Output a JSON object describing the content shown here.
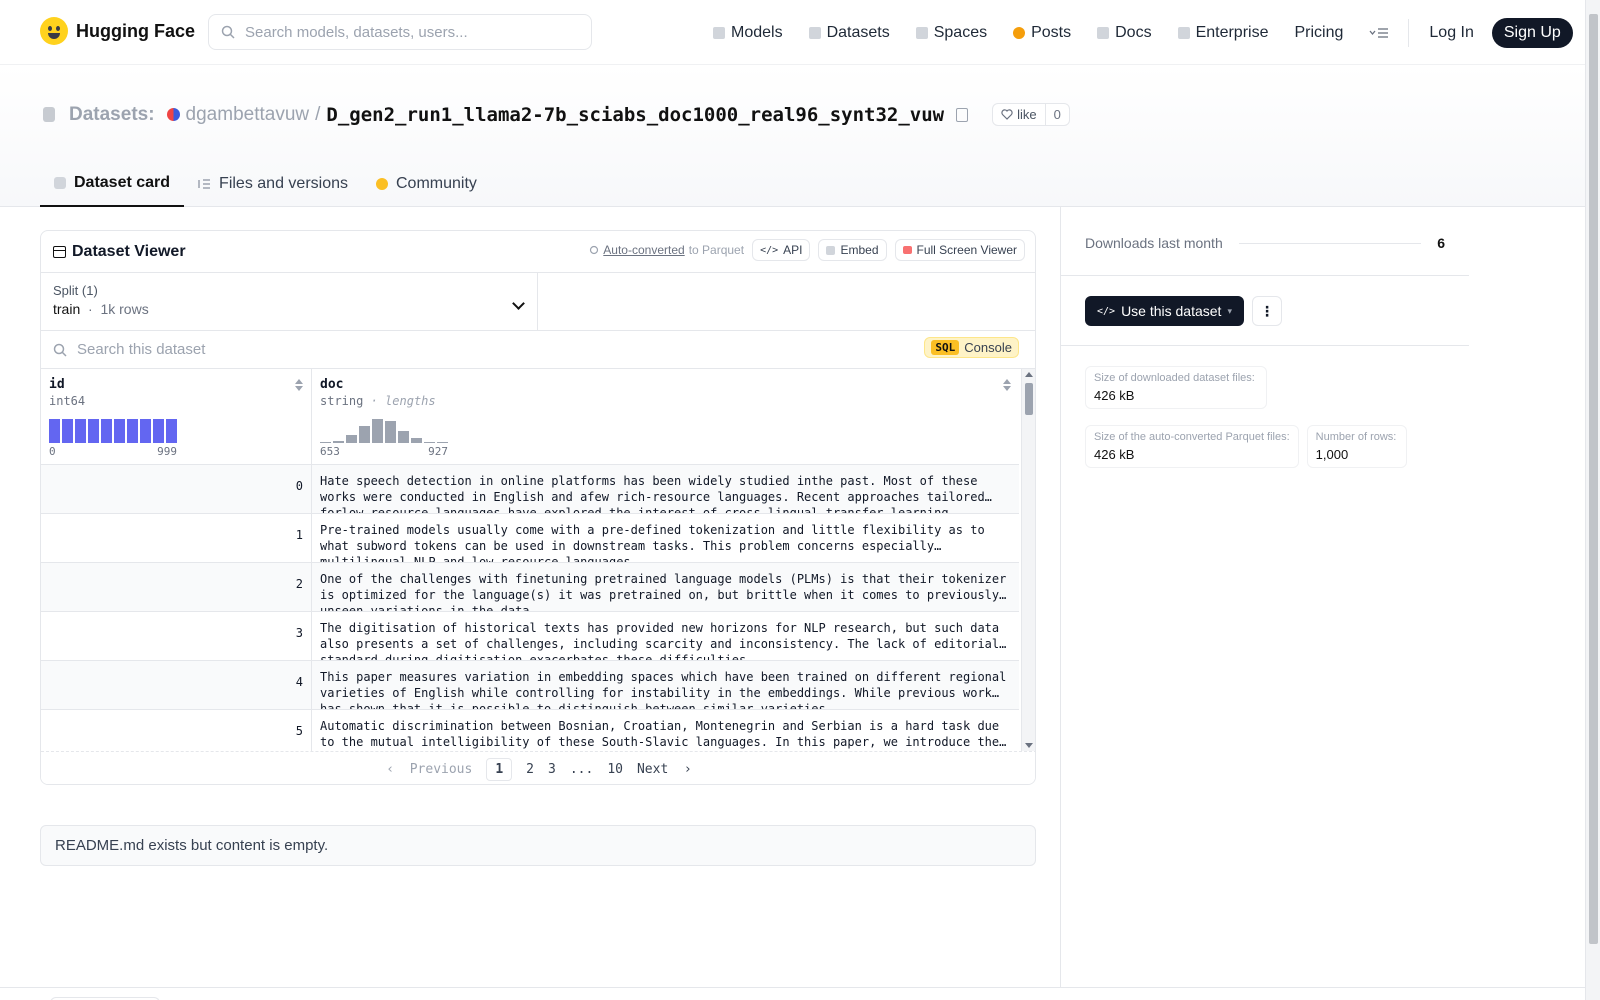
{
  "nav": {
    "brand": "Hugging Face",
    "search_placeholder": "Search models, datasets, users...",
    "links": [
      {
        "label": "Models",
        "color": "#d1d5db"
      },
      {
        "label": "Datasets",
        "color": "#d1d5db"
      },
      {
        "label": "Spaces",
        "color": "#d1d5db"
      },
      {
        "label": "Posts",
        "color": "#f59e0b"
      },
      {
        "label": "Docs",
        "color": "#d1d5db"
      },
      {
        "label": "Enterprise",
        "color": "#d1d5db"
      }
    ],
    "pricing": "Pricing",
    "login": "Log In",
    "signup": "Sign Up"
  },
  "header": {
    "section": "Datasets:",
    "owner": "dgambettavuw",
    "slash": "/",
    "name": "D_gen2_run1_llama2-7b_sciabs_doc1000_real96_synt32_vuw",
    "like_label": "like",
    "like_count": "0",
    "tabs": [
      "Dataset card",
      "Files and versions",
      "Community"
    ]
  },
  "viewer": {
    "title": "Dataset Viewer",
    "autoconv_link": "Auto-converted",
    "autoconv_suffix": "to Parquet",
    "api": "API",
    "embed": "Embed",
    "fullscreen": "Full Screen Viewer",
    "split_label": "Split (1)",
    "split_name": "train",
    "split_rows": "1k rows",
    "search_placeholder": "Search this dataset",
    "sql_badge": "SQL",
    "sql_label": "Console",
    "columns": [
      {
        "name": "id",
        "type": "int64",
        "min": "0",
        "max": "999",
        "hist": [
          1,
          1,
          1,
          1,
          1,
          1,
          1,
          1,
          1,
          1
        ]
      },
      {
        "name": "doc",
        "type": "string",
        "type_hint": "· lengths",
        "min": "653",
        "max": "927",
        "hist": [
          0.04,
          0.08,
          0.35,
          0.7,
          1.0,
          0.9,
          0.5,
          0.2,
          0.06,
          0.03
        ]
      }
    ],
    "rows": [
      {
        "id": "0",
        "doc": "Hate speech detection in online platforms has been widely studied inthe past. Most of these works were conducted in English and afew rich-resource languages. Recent approaches tailored forlow-resource languages have explored the interest of cross-lingual transfer learning."
      },
      {
        "id": "1",
        "doc": "Pre-trained models usually come with a pre-defined tokenization and little flexibility as to what subword tokens can be used in downstream tasks. This problem concerns especially multilingual NLP and low-resource languages."
      },
      {
        "id": "2",
        "doc": "One of the challenges with finetuning pretrained language models (PLMs) is that their tokenizer is optimized for the language(s) it was pretrained on, but brittle when it comes to previously unseen variations in the data."
      },
      {
        "id": "3",
        "doc": "The digitisation of historical texts has provided new horizons for NLP research, but such data also presents a set of challenges, including scarcity and inconsistency. The lack of editorial standard during digitisation exacerbates these difficulties."
      },
      {
        "id": "4",
        "doc": "This paper measures variation in embedding spaces which have been trained on different regional varieties of English while controlling for instability in the embeddings. While previous work has shown that it is possible to distinguish between similar varieties."
      },
      {
        "id": "5",
        "doc": "Automatic discrimination between Bosnian, Croatian, Montenegrin and Serbian is a hard task due to the mutual intelligibility of these South-Slavic languages. In this paper, we introduce the BENCHić-lang benchmark for discriminating between these languages."
      }
    ],
    "pager": {
      "prev": "Previous",
      "pages": [
        "1",
        "2",
        "3",
        "...",
        "10"
      ],
      "next": "Next"
    }
  },
  "readme": "README.md exists but content is empty.",
  "sidebar": {
    "downloads_label": "Downloads last month",
    "downloads_value": "6",
    "use_button": "Use this dataset",
    "stats": [
      {
        "key": "Size of downloaded dataset files:",
        "value": "426 kB"
      },
      {
        "key": "Size of the auto-converted Parquet files:",
        "value": "426 kB"
      },
      {
        "key": "Number of rows:",
        "value": "1,000"
      }
    ]
  }
}
